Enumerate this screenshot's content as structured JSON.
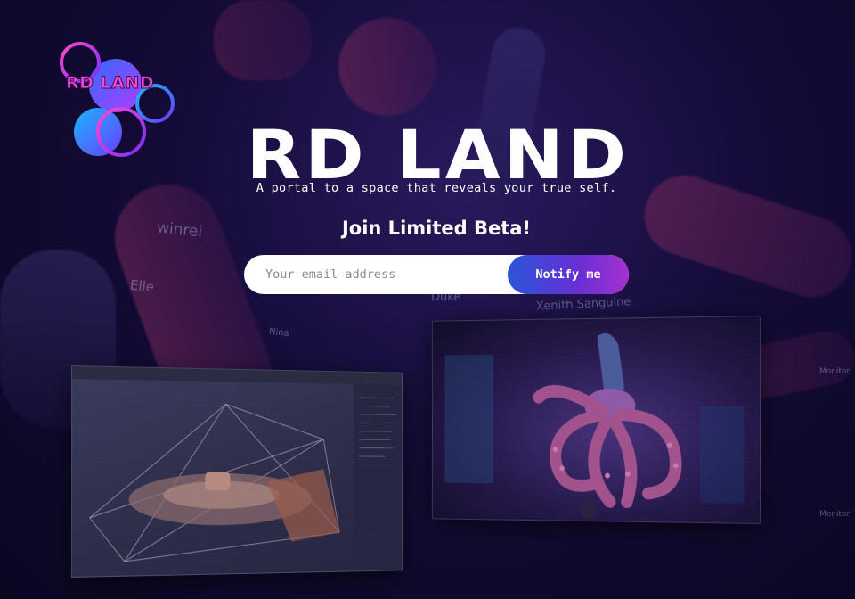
{
  "brand": {
    "logo_text": "RD LAND",
    "title": "RD LAND",
    "tagline": "A portal to a space that reveals your true self."
  },
  "signup": {
    "heading": "Join Limited Beta!",
    "email_placeholder": "Your email address",
    "email_value": "",
    "button_label": "Notify me"
  },
  "background_labels": [
    "winrei",
    "Elle",
    "Duke",
    "Xenith Sanguine",
    "Nina",
    "Monitor",
    "Monitor"
  ],
  "colors": {
    "background": "#140b38",
    "accent_gradient_start": "#2a55d9",
    "accent_gradient_end": "#a431d0",
    "logo_pink": "#ff49c9",
    "logo_blue": "#2f6bff"
  },
  "icons": {
    "logo": "rd-land-bubbles-logo"
  }
}
